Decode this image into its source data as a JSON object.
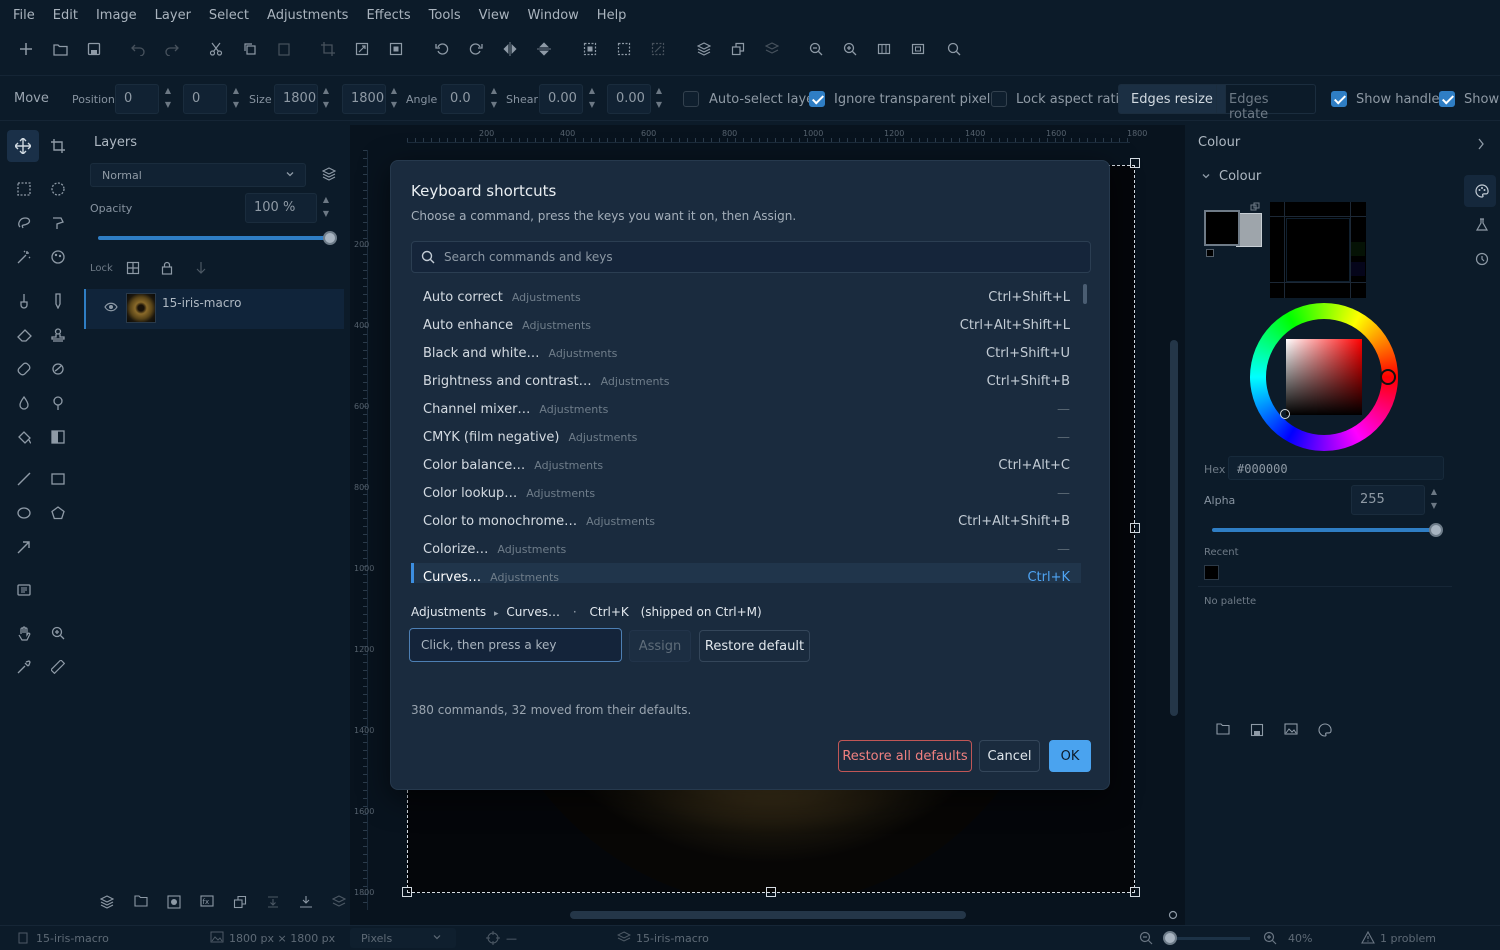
{
  "menubar": [
    "File",
    "Edit",
    "Image",
    "Layer",
    "Select",
    "Adjustments",
    "Effects",
    "Tools",
    "View",
    "Window",
    "Help"
  ],
  "options": {
    "tool_name": "Move",
    "position_label": "Position",
    "pos_x": "0",
    "pos_y": "0",
    "size_label": "Size",
    "size_w": "1800",
    "size_h": "1800",
    "angle_label": "Angle",
    "angle": "0.0",
    "shear_label": "Shear",
    "shear_x": "0.00",
    "shear_y": "0.00",
    "auto_select": "Auto-select layer",
    "ignore_transparent": "Ignore transparent pixels",
    "lock_aspect": "Lock aspect ratio",
    "edges_resize": "Edges resize",
    "edges_rotate": "Edges rotate",
    "show_handles": "Show handles",
    "show_more": "Show"
  },
  "layers": {
    "title": "Layers",
    "blend_mode": "Normal",
    "opacity_label": "Opacity",
    "opacity_value": "100 %",
    "opacity_fraction": 1.0,
    "lock_label": "Lock",
    "layer_name": "15-iris-macro"
  },
  "ruler": {
    "top": [
      "200",
      "400",
      "600",
      "800",
      "1000",
      "1200",
      "1400",
      "1600",
      "1800"
    ],
    "left": [
      "200",
      "400",
      "600",
      "800",
      "1000",
      "1200",
      "1400",
      "1600",
      "1800"
    ]
  },
  "colour": {
    "panel_title": "Colour",
    "section_title": "Colour",
    "hex_label": "Hex",
    "hex_value": "#000000",
    "alpha_label": "Alpha",
    "alpha_value": "255",
    "recent_label": "Recent",
    "no_palette": "No palette",
    "accent": "#2f7ec4"
  },
  "dialog": {
    "title": "Keyboard shortcuts",
    "subtitle": "Choose a command, press the keys you want it on, then Assign.",
    "search_placeholder": "Search commands and keys",
    "rows": [
      {
        "cmd": "Auto correct",
        "cat": "Adjustments",
        "keys": "Ctrl+Shift+L"
      },
      {
        "cmd": "Auto enhance",
        "cat": "Adjustments",
        "keys": "Ctrl+Alt+Shift+L"
      },
      {
        "cmd": "Black and white…",
        "cat": "Adjustments",
        "keys": "Ctrl+Shift+U"
      },
      {
        "cmd": "Brightness and contrast…",
        "cat": "Adjustments",
        "keys": "Ctrl+Shift+B"
      },
      {
        "cmd": "Channel mixer…",
        "cat": "Adjustments",
        "keys": "—"
      },
      {
        "cmd": "CMYK (film negative)",
        "cat": "Adjustments",
        "keys": "—"
      },
      {
        "cmd": "Color balance…",
        "cat": "Adjustments",
        "keys": "Ctrl+Alt+C"
      },
      {
        "cmd": "Color lookup…",
        "cat": "Adjustments",
        "keys": "—"
      },
      {
        "cmd": "Color to monochrome…",
        "cat": "Adjustments",
        "keys": "Ctrl+Alt+Shift+B"
      },
      {
        "cmd": "Colorize…",
        "cat": "Adjustments",
        "keys": "—"
      },
      {
        "cmd": "Curves…",
        "cat": "Adjustments",
        "keys": "Ctrl+K"
      }
    ],
    "selected_index": 10,
    "path_category": "Adjustments",
    "path_sep": "▸",
    "path_command": "Curves…",
    "path_dot": "·",
    "path_keys": "Ctrl+K",
    "path_shipped": "(shipped on Ctrl+M)",
    "key_input_placeholder": "Click, then press a key",
    "assign": "Assign",
    "restore_default": "Restore default",
    "summary": "380 commands, 32 moved from their defaults.",
    "restore_all": "Restore all defaults",
    "cancel": "Cancel",
    "ok": "OK"
  },
  "status": {
    "doc": "15-iris-macro",
    "dimensions": "1800 px × 1800 px",
    "units": "Pixels",
    "cursor": "—",
    "layer": "15-iris-macro",
    "zoom": "40%",
    "problems": "1 problem"
  }
}
